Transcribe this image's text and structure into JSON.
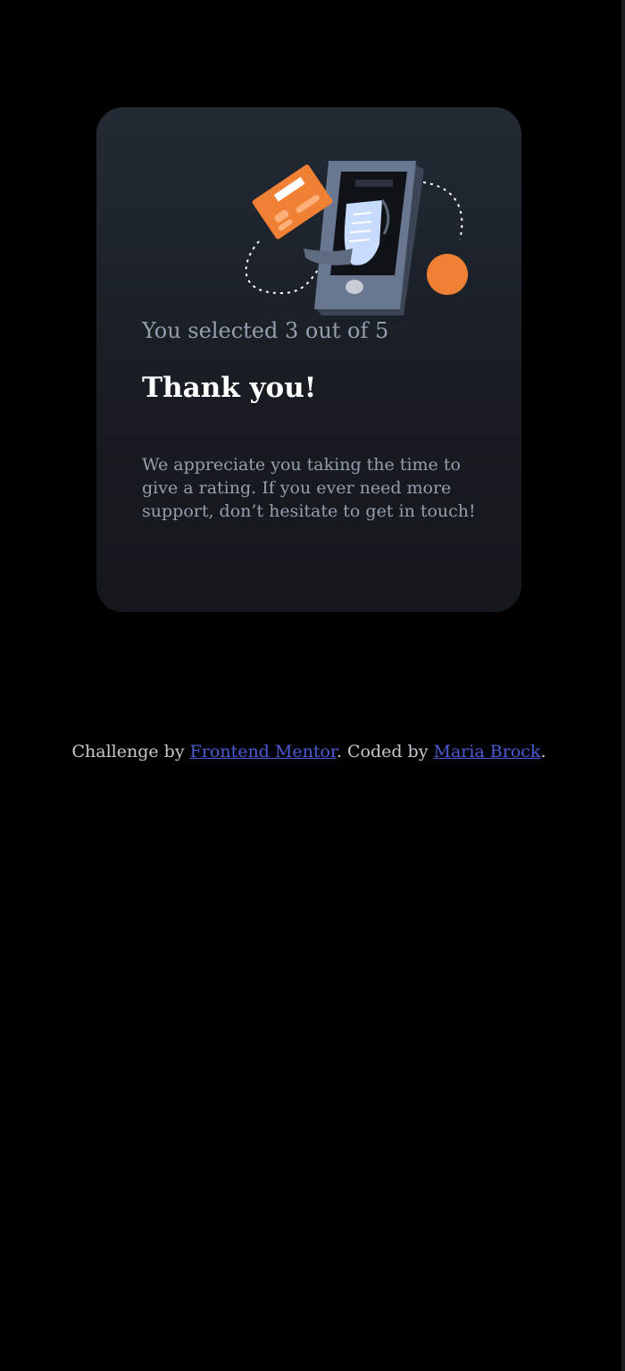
{
  "card": {
    "selected_text": "You selected 3 out of 5",
    "title": "Thank you!",
    "message": "We appreciate you taking the time to give a rating. If you ever need more support, don’t hesitate to get in touch!",
    "illustration_icon": "phone-payment-illustration-icon"
  },
  "attribution": {
    "prefix": "Challenge by ",
    "challenge_link": "Frontend Mentor",
    "middle": ". Coded by ",
    "author_link": "Maria Brock",
    "suffix": "."
  },
  "colors": {
    "background": "#000000",
    "card": "#232a34",
    "accent": "#f08033",
    "muted_text": "#959eac",
    "link": "#4d5cd6"
  }
}
